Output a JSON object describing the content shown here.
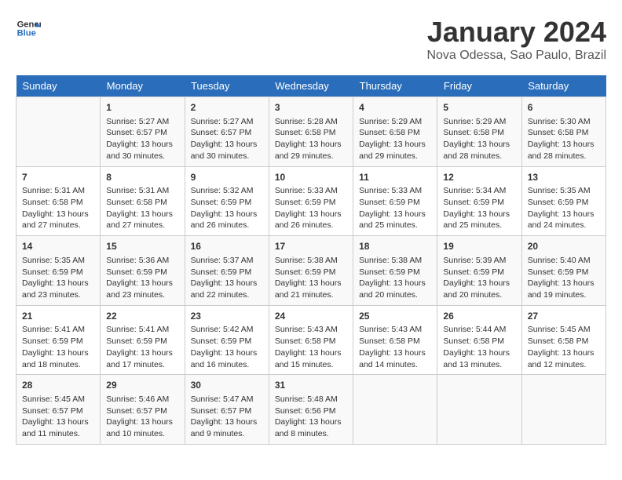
{
  "header": {
    "logo_line1": "General",
    "logo_line2": "Blue",
    "month_title": "January 2024",
    "location": "Nova Odessa, Sao Paulo, Brazil"
  },
  "weekdays": [
    "Sunday",
    "Monday",
    "Tuesday",
    "Wednesday",
    "Thursday",
    "Friday",
    "Saturday"
  ],
  "weeks": [
    [
      {
        "day": "",
        "info": ""
      },
      {
        "day": "1",
        "info": "Sunrise: 5:27 AM\nSunset: 6:57 PM\nDaylight: 13 hours\nand 30 minutes."
      },
      {
        "day": "2",
        "info": "Sunrise: 5:27 AM\nSunset: 6:57 PM\nDaylight: 13 hours\nand 30 minutes."
      },
      {
        "day": "3",
        "info": "Sunrise: 5:28 AM\nSunset: 6:58 PM\nDaylight: 13 hours\nand 29 minutes."
      },
      {
        "day": "4",
        "info": "Sunrise: 5:29 AM\nSunset: 6:58 PM\nDaylight: 13 hours\nand 29 minutes."
      },
      {
        "day": "5",
        "info": "Sunrise: 5:29 AM\nSunset: 6:58 PM\nDaylight: 13 hours\nand 28 minutes."
      },
      {
        "day": "6",
        "info": "Sunrise: 5:30 AM\nSunset: 6:58 PM\nDaylight: 13 hours\nand 28 minutes."
      }
    ],
    [
      {
        "day": "7",
        "info": "Sunrise: 5:31 AM\nSunset: 6:58 PM\nDaylight: 13 hours\nand 27 minutes."
      },
      {
        "day": "8",
        "info": "Sunrise: 5:31 AM\nSunset: 6:58 PM\nDaylight: 13 hours\nand 27 minutes."
      },
      {
        "day": "9",
        "info": "Sunrise: 5:32 AM\nSunset: 6:59 PM\nDaylight: 13 hours\nand 26 minutes."
      },
      {
        "day": "10",
        "info": "Sunrise: 5:33 AM\nSunset: 6:59 PM\nDaylight: 13 hours\nand 26 minutes."
      },
      {
        "day": "11",
        "info": "Sunrise: 5:33 AM\nSunset: 6:59 PM\nDaylight: 13 hours\nand 25 minutes."
      },
      {
        "day": "12",
        "info": "Sunrise: 5:34 AM\nSunset: 6:59 PM\nDaylight: 13 hours\nand 25 minutes."
      },
      {
        "day": "13",
        "info": "Sunrise: 5:35 AM\nSunset: 6:59 PM\nDaylight: 13 hours\nand 24 minutes."
      }
    ],
    [
      {
        "day": "14",
        "info": "Sunrise: 5:35 AM\nSunset: 6:59 PM\nDaylight: 13 hours\nand 23 minutes."
      },
      {
        "day": "15",
        "info": "Sunrise: 5:36 AM\nSunset: 6:59 PM\nDaylight: 13 hours\nand 23 minutes."
      },
      {
        "day": "16",
        "info": "Sunrise: 5:37 AM\nSunset: 6:59 PM\nDaylight: 13 hours\nand 22 minutes."
      },
      {
        "day": "17",
        "info": "Sunrise: 5:38 AM\nSunset: 6:59 PM\nDaylight: 13 hours\nand 21 minutes."
      },
      {
        "day": "18",
        "info": "Sunrise: 5:38 AM\nSunset: 6:59 PM\nDaylight: 13 hours\nand 20 minutes."
      },
      {
        "day": "19",
        "info": "Sunrise: 5:39 AM\nSunset: 6:59 PM\nDaylight: 13 hours\nand 20 minutes."
      },
      {
        "day": "20",
        "info": "Sunrise: 5:40 AM\nSunset: 6:59 PM\nDaylight: 13 hours\nand 19 minutes."
      }
    ],
    [
      {
        "day": "21",
        "info": "Sunrise: 5:41 AM\nSunset: 6:59 PM\nDaylight: 13 hours\nand 18 minutes."
      },
      {
        "day": "22",
        "info": "Sunrise: 5:41 AM\nSunset: 6:59 PM\nDaylight: 13 hours\nand 17 minutes."
      },
      {
        "day": "23",
        "info": "Sunrise: 5:42 AM\nSunset: 6:59 PM\nDaylight: 13 hours\nand 16 minutes."
      },
      {
        "day": "24",
        "info": "Sunrise: 5:43 AM\nSunset: 6:58 PM\nDaylight: 13 hours\nand 15 minutes."
      },
      {
        "day": "25",
        "info": "Sunrise: 5:43 AM\nSunset: 6:58 PM\nDaylight: 13 hours\nand 14 minutes."
      },
      {
        "day": "26",
        "info": "Sunrise: 5:44 AM\nSunset: 6:58 PM\nDaylight: 13 hours\nand 13 minutes."
      },
      {
        "day": "27",
        "info": "Sunrise: 5:45 AM\nSunset: 6:58 PM\nDaylight: 13 hours\nand 12 minutes."
      }
    ],
    [
      {
        "day": "28",
        "info": "Sunrise: 5:45 AM\nSunset: 6:57 PM\nDaylight: 13 hours\nand 11 minutes."
      },
      {
        "day": "29",
        "info": "Sunrise: 5:46 AM\nSunset: 6:57 PM\nDaylight: 13 hours\nand 10 minutes."
      },
      {
        "day": "30",
        "info": "Sunrise: 5:47 AM\nSunset: 6:57 PM\nDaylight: 13 hours\nand 9 minutes."
      },
      {
        "day": "31",
        "info": "Sunrise: 5:48 AM\nSunset: 6:56 PM\nDaylight: 13 hours\nand 8 minutes."
      },
      {
        "day": "",
        "info": ""
      },
      {
        "day": "",
        "info": ""
      },
      {
        "day": "",
        "info": ""
      }
    ]
  ]
}
